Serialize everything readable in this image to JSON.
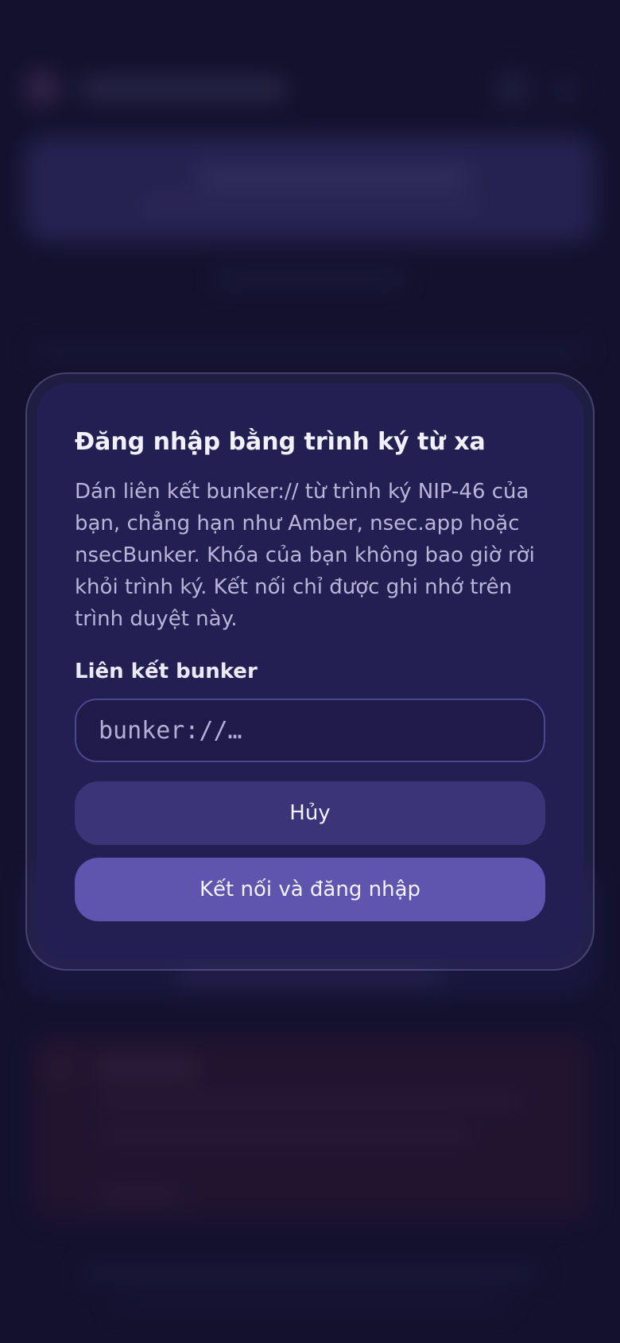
{
  "modal": {
    "title": "Đăng nhập bằng trình ký từ xa",
    "description": "Dán liên kết bunker:// từ trình ký NIP-46 của bạn, chẳng hạn như Amber, nsec.app hoặc nsecBunker. Khóa của bạn không bao giờ rời khỏi trình ký. Kết nối chỉ được ghi nhớ trên trình duyệt này.",
    "field_label": "Liên kết bunker",
    "input": {
      "value": "",
      "placeholder": "bunker://…"
    },
    "cancel_label": "Hủy",
    "connect_label": "Kết nối và đăng nhập"
  },
  "colors": {
    "background": "#1a1736",
    "modal_background": "#241f52",
    "cancel_button": "#3b3478",
    "connect_button": "#5f54ae",
    "title_text": "#f1effa",
    "body_text": "#b9b4d8"
  }
}
